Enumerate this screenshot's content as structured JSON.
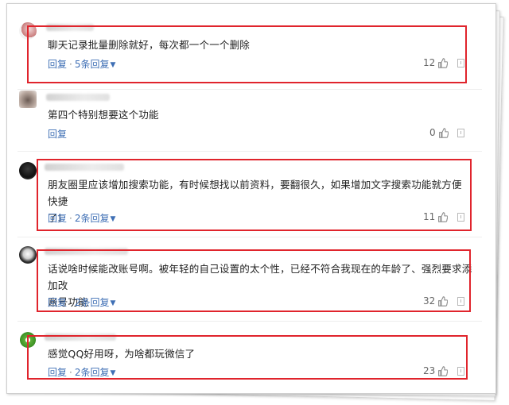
{
  "comments": [
    {
      "text": "聊天记录批量删除就好，每次都一个一个删除",
      "reply": "回复",
      "replies": "5条回复",
      "likes": "12"
    },
    {
      "text": "第四个特别想要这个功能",
      "reply": "回复",
      "replies": "",
      "likes": "0"
    },
    {
      "text": "朋友圈里应该增加搜索功能，有时候想找以前资料，要翻很久，如果增加文字搜索功能就方便快捷了!",
      "text_line1": "朋友圈里应该增加搜索功能，有时候想找以前资料，要翻很久，如果增加文字搜索功能就方便快捷",
      "text_line2": "了!",
      "reply": "回复",
      "replies": "2条回复",
      "likes": "11"
    },
    {
      "text": "话说啥时候能改账号啊。被年轻的自己设置的太个性，已经不符合我现在的年龄了、强烈要求添加改账号功能",
      "text_line1": "话说啥时候能改账号啊。被年轻的自己设置的太个性，已经不符合我现在的年龄了、强烈要求添加改",
      "text_line2": "账号功能",
      "reply": "回复",
      "replies": "2条回复",
      "likes": "32"
    },
    {
      "text": "感觉QQ好用呀，为啥都玩微信了",
      "reply": "回复",
      "replies": "2条回复",
      "likes": "23"
    }
  ],
  "separator": "·",
  "colors": {
    "highlight": "#e0242c",
    "link": "#3f6fb5",
    "text": "#222222"
  },
  "icons": {
    "like": "thumbs-up-icon",
    "report": "report-icon",
    "expand": "chevron-down-icon"
  }
}
